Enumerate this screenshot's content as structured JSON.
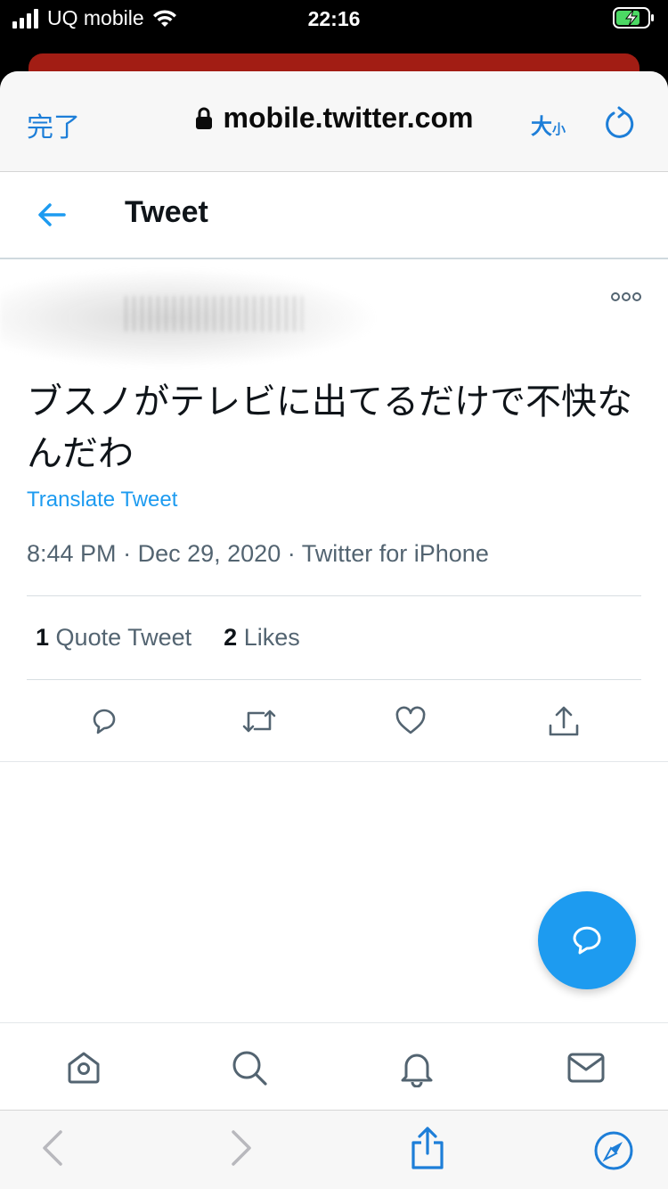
{
  "status_bar": {
    "carrier": "UQ mobile",
    "time": "22:16",
    "signal_bars": 4,
    "battery_state": "charging"
  },
  "browser": {
    "done_label": "完了",
    "url": "mobile.twitter.com",
    "text_size_big": "大",
    "text_size_small": "小",
    "lock_icon": "lock-icon",
    "reload_icon": "reload-icon",
    "accent_color": "#1d7ed8"
  },
  "header": {
    "title": "Tweet",
    "back_icon": "back-arrow-icon"
  },
  "tweet": {
    "text": "ブスノがテレビに出てるだけで不快なんだわ",
    "translate_label": "Translate Tweet",
    "time": "8:44 PM",
    "date": "Dec 29, 2020",
    "source": "Twitter for iPhone",
    "separator": "·",
    "quote_count": "1",
    "quote_label": "Quote Tweet",
    "like_count": "2",
    "like_label": "Likes",
    "brand_color": "#1d9bf0"
  },
  "bottom_nav": {
    "items": [
      "home-icon",
      "search-icon",
      "notifications-icon",
      "messages-icon"
    ]
  },
  "safari_toolbar": {
    "items": [
      "back-icon",
      "forward-icon",
      "share-icon",
      "compass-icon"
    ]
  }
}
